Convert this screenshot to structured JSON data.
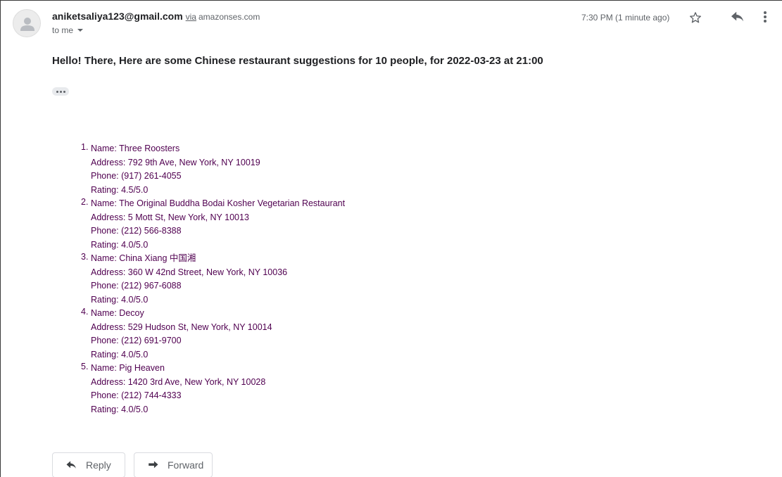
{
  "header": {
    "sender_email": "aniketsaliya123@gmail.com",
    "via_label": "via",
    "via_domain": "amazonses.com",
    "recipient_label": "to me",
    "timestamp": "7:30 PM (1 minute ago)"
  },
  "icons": {
    "avatar": "avatar-person-icon",
    "star": "star-outline-icon",
    "reply": "reply-arrow-icon",
    "more": "more-vertical-icon",
    "recipient_dropdown": "chevron-down-icon",
    "forward": "forward-arrow-icon"
  },
  "message": {
    "subject": "Hello! There, Here are some Chinese restaurant suggestions for 10 people, for 2022-03-23 at 21:00",
    "restaurants": [
      {
        "number": "1.",
        "name": "Name: Three Roosters",
        "address": "Address: 792 9th Ave, New York, NY 10019",
        "phone": "Phone: (917) 261-4055",
        "rating": "Rating: 4.5/5.0"
      },
      {
        "number": "2.",
        "name": "Name: The Original Buddha Bodai Kosher Vegetarian Restaurant",
        "address": "Address: 5 Mott St, New York, NY 10013",
        "phone": "Phone: (212) 566-8388",
        "rating": "Rating: 4.0/5.0"
      },
      {
        "number": "3.",
        "name": "Name: China Xiang 中国湘",
        "address": "Address: 360 W 42nd Street, New York, NY 10036",
        "phone": "Phone: (212) 967-6088",
        "rating": "Rating: 4.0/5.0"
      },
      {
        "number": "4.",
        "name": "Name: Decoy",
        "address": "Address: 529 Hudson St, New York, NY 10014",
        "phone": "Phone: (212) 691-9700",
        "rating": "Rating: 4.0/5.0"
      },
      {
        "number": "5.",
        "name": "Name: Pig Heaven",
        "address": "Address: 1420 3rd Ave, New York, NY 10028",
        "phone": "Phone: (212) 744-4333",
        "rating": "Rating: 4.0/5.0"
      }
    ]
  },
  "actions": {
    "reply_label": "Reply",
    "forward_label": "Forward"
  },
  "colors": {
    "link_text": "#500050",
    "primary_text": "#202124",
    "secondary_text": "#5f6368",
    "button_border": "#dadce0"
  }
}
